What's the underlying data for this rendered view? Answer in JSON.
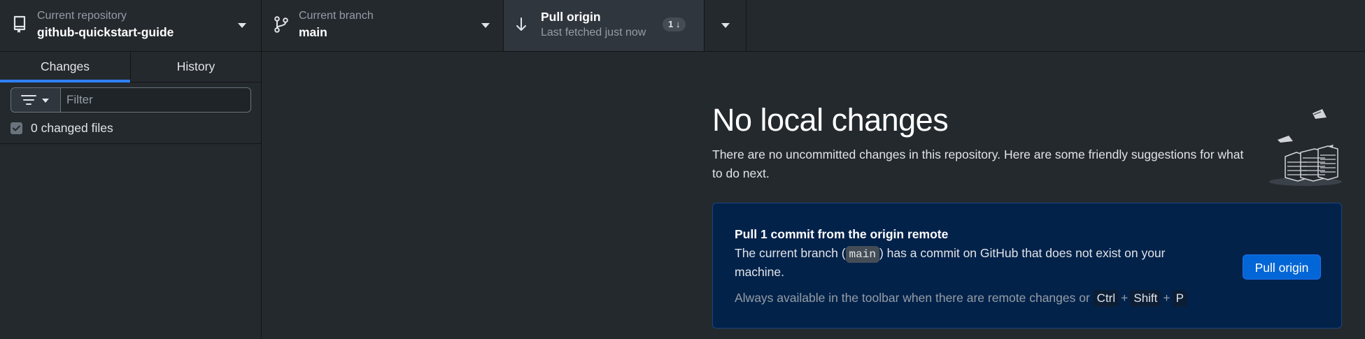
{
  "toolbar": {
    "repository": {
      "label": "Current repository",
      "value": "github-quickstart-guide"
    },
    "branch": {
      "label": "Current branch",
      "value": "main"
    },
    "pull": {
      "title": "Pull origin",
      "subtitle": "Last fetched just now",
      "badge_count": "1"
    }
  },
  "sidebar": {
    "tabs": [
      {
        "label": "Changes",
        "selected": true
      },
      {
        "label": "History",
        "selected": false
      }
    ],
    "filter": {
      "placeholder": "Filter",
      "value": ""
    },
    "changed_files_label": "0 changed files"
  },
  "main": {
    "heading": "No local changes",
    "intro": "There are no uncommitted changes in this repository. Here are some friendly suggestions for what to do next.",
    "card": {
      "title": "Pull 1 commit from the origin remote",
      "desc_before": "The current branch (",
      "branch_code": "main",
      "desc_after": ") has a commit on GitHub that does not exist on your machine.",
      "hint": "Always available in the toolbar when there are remote changes or",
      "keys": [
        "Ctrl",
        "Shift",
        "P"
      ],
      "key_separator": "+",
      "button_label": "Pull origin"
    }
  },
  "colors": {
    "background": "#24292e",
    "accent": "#2f81f7",
    "card_background": "#03224a",
    "button": "#0366d6"
  },
  "icons": [
    "repo-icon",
    "branch-icon",
    "arrow-down-icon",
    "filter-icon",
    "caret-down-icon",
    "checkbox-icon"
  ]
}
